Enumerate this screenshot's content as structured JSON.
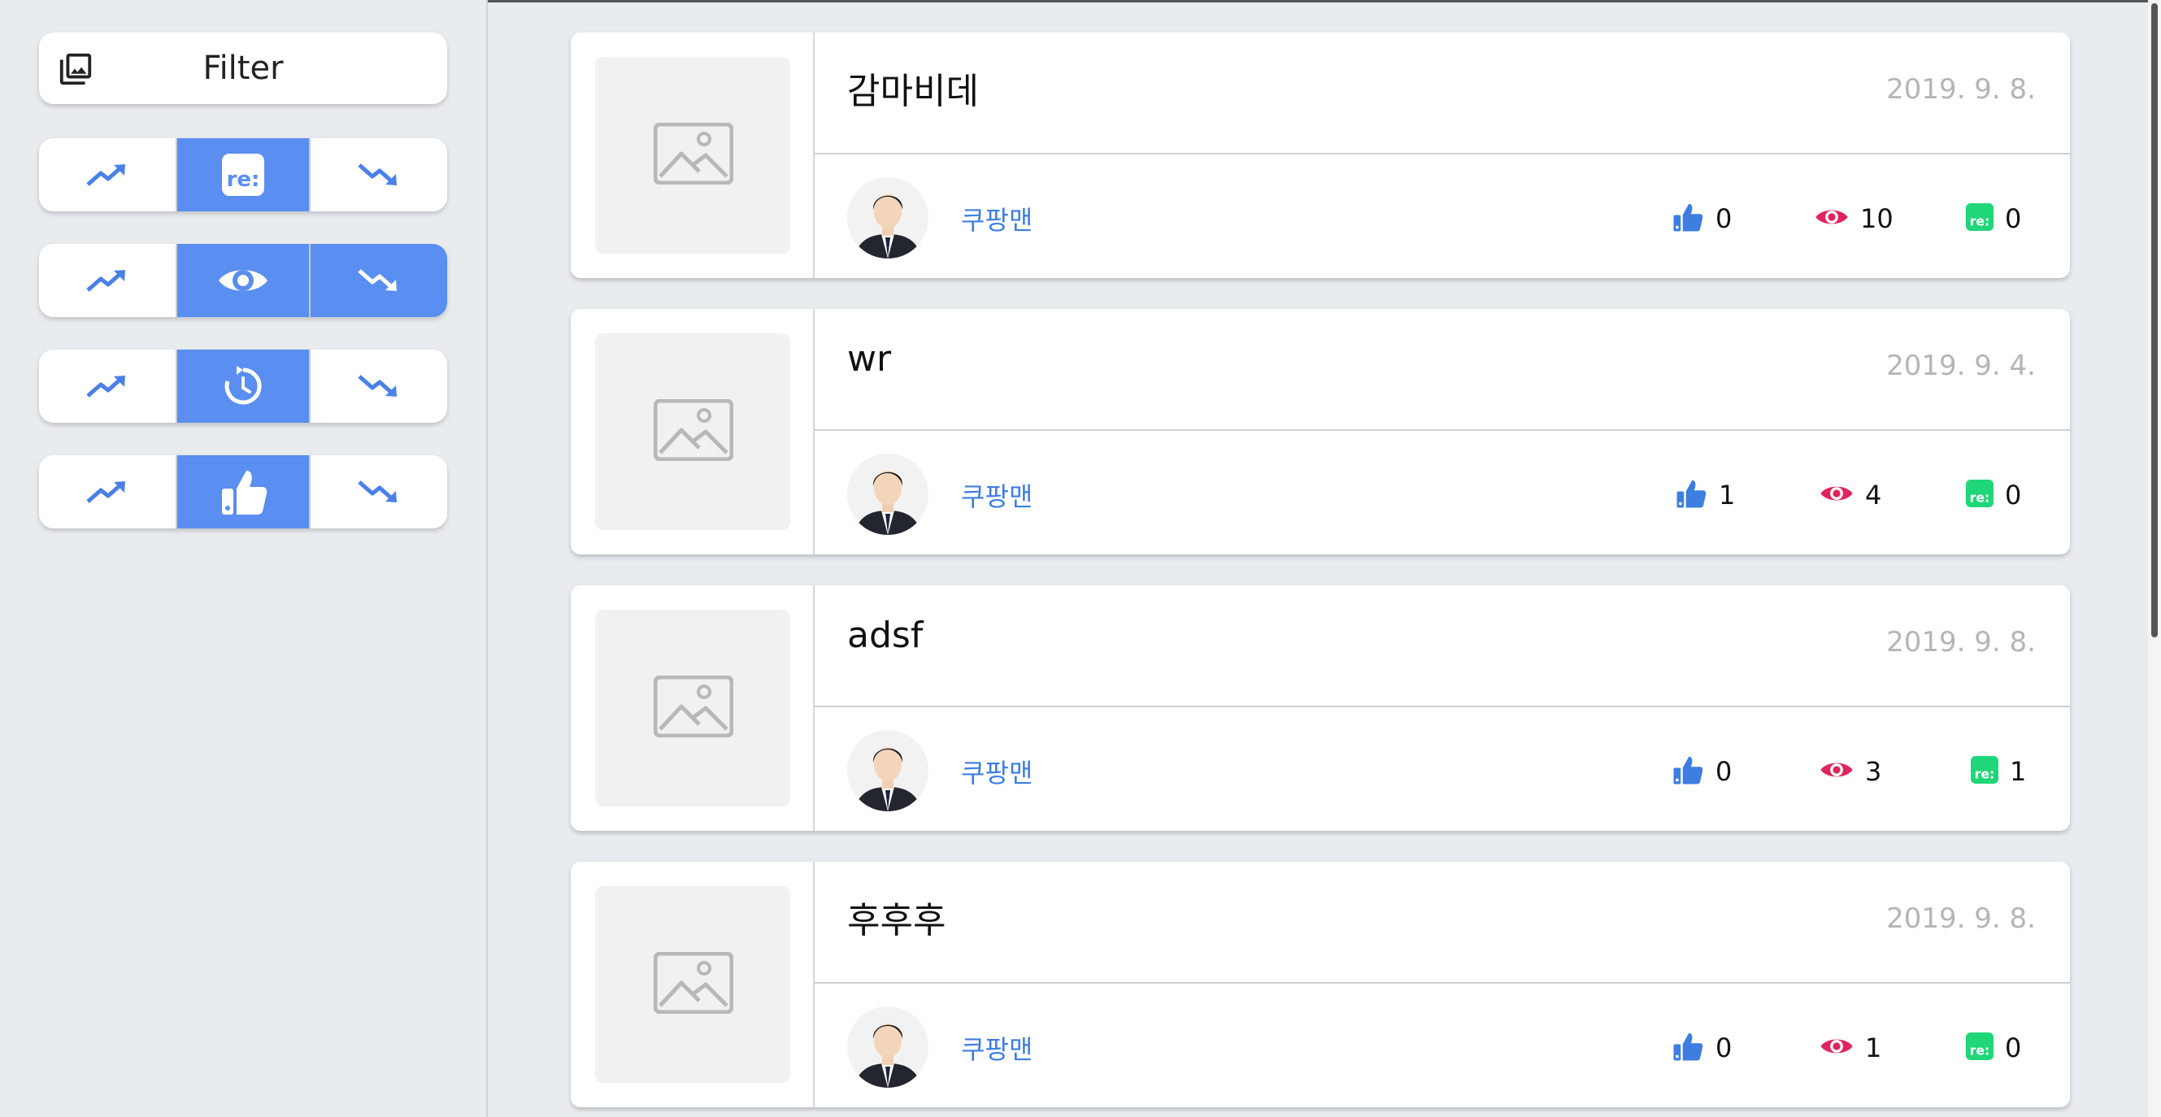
{
  "filter": {
    "label": "Filter",
    "icon": "photo-library-icon"
  },
  "sort_groups": [
    {
      "name": "reply",
      "icon": "re-icon",
      "active_segment": "middle"
    },
    {
      "name": "view",
      "icon": "eye-icon",
      "active_segment": "middle-and-down"
    },
    {
      "name": "recent",
      "icon": "history-clock-icon",
      "active_segment": "middle"
    },
    {
      "name": "like",
      "icon": "thumb-up-icon",
      "active_segment": "middle"
    }
  ],
  "colors": {
    "accent_blue": "#5a8ef0",
    "author_blue": "#3d7ee0",
    "eye_red": "#e0245e",
    "reply_green": "#1fd679",
    "date_gray": "#b5b5b5"
  },
  "posts": [
    {
      "title": "감마비데",
      "date": "2019. 9. 8.",
      "author": "쿠팡맨",
      "likes": "0",
      "views": "10",
      "replies": "0"
    },
    {
      "title": "wr",
      "date": "2019. 9. 4.",
      "author": "쿠팡맨",
      "likes": "1",
      "views": "4",
      "replies": "0"
    },
    {
      "title": "adsf",
      "date": "2019. 9. 8.",
      "author": "쿠팡맨",
      "likes": "0",
      "views": "3",
      "replies": "1"
    },
    {
      "title": "후후후",
      "date": "2019. 9. 8.",
      "author": "쿠팡맨",
      "likes": "0",
      "views": "1",
      "replies": "0"
    }
  ],
  "stat_icons": {
    "like": "thumb-up-icon",
    "view": "eye-icon",
    "reply": "re-icon"
  }
}
